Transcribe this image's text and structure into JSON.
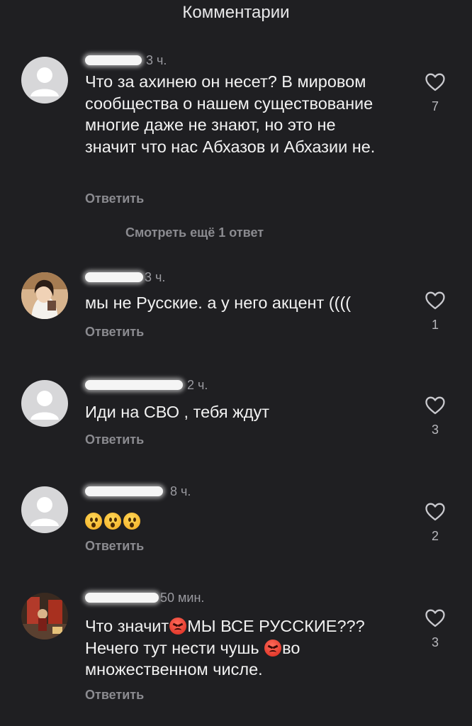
{
  "header": {
    "title": "Комментарии"
  },
  "comments": [
    {
      "time": "3 ч.",
      "text": "Что за ахинею он несет?  В мировом сообщества о нашем существование многие даже не знают, но это не значит что нас Абхазов и Абхазии не.",
      "reply_label": "Ответить",
      "like_count": "7"
    },
    {
      "time": "3 ч.",
      "text": "мы не Русские. а у него акцент ((((",
      "reply_label": "Ответить",
      "like_count": "1"
    },
    {
      "time": "2 ч.",
      "text": "Иди на СВО , тебя ждут",
      "reply_label": "Ответить",
      "like_count": "3"
    },
    {
      "time": "8 ч.",
      "text": "",
      "reply_label": "Ответить",
      "like_count": "2"
    },
    {
      "time": "50 мин.",
      "text_part1": "Что значит",
      "text_part2": "МЫ ВСЕ РУССКИЕ??? Нечего тут нести чушь ",
      "text_part3": "во множественном числе.",
      "reply_label": "Ответить",
      "like_count": "3"
    }
  ],
  "more_replies": "Смотреть ещё 1 ответ",
  "icons": {
    "like": "heart-outline-icon",
    "emoji_wow": "astonished-face-icon",
    "emoji_angry": "angry-face-icon"
  },
  "colors": {
    "background": "#1f1f22",
    "secondary_text": "#8b8b90"
  }
}
